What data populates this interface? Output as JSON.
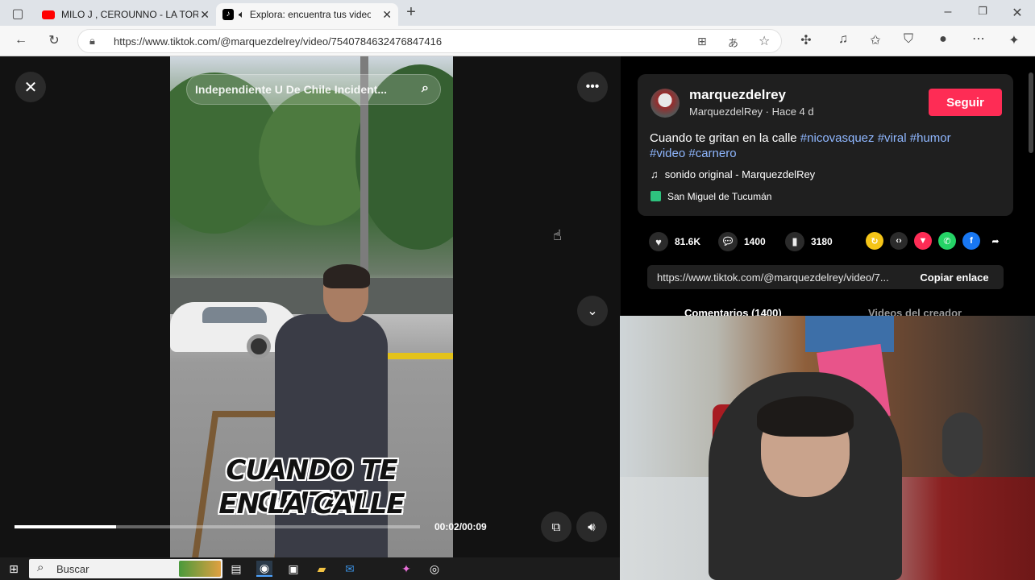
{
  "browser": {
    "tabs": [
      {
        "label": "MILO J , CEROUNNO - LA TORTUGA",
        "icon": "youtube-icon"
      },
      {
        "label": "Explora: encuentra tus videos",
        "icon": "tiktok-icon"
      }
    ],
    "new_tab_symbol": "+",
    "url": "https://www.tiktok.com/@marquezdelrey/video/7540784632476847416",
    "window_controls": {
      "minimize": "–",
      "restore": "❐",
      "close": "✕"
    }
  },
  "video": {
    "search_text": "Independiente U De Chile Incident...",
    "caption_line1": "CUANDO TE GRITAN",
    "caption_line2": "EN LA CALLE",
    "timecode": "00:02/00:09",
    "progress_fraction": 0.25
  },
  "panel": {
    "username": "marquezdelrey",
    "subline": "MarquezdelRey · Hace 4 d",
    "follow_label": "Seguir",
    "description_text": "Cuando te gritan en la calle",
    "hashtags_line1": [
      "#nicovasquez",
      "#viral",
      "#humor"
    ],
    "hashtags_line2": [
      "#video",
      "#carnero"
    ],
    "sound": "sonido original - MarquezdelRey",
    "location": "San Miguel de Tucumán",
    "likes": "81.6K",
    "comments": "1400",
    "saves": "3180",
    "link": "https://www.tiktok.com/@marquezdelrey/video/7...",
    "copy_label": "Copiar enlace",
    "tab_comments": "Comentarios (1400)",
    "tab_creator": "Videos del creador",
    "accent": "#fe2c55",
    "hashtag_color": "#8fb7ff"
  },
  "taskbar": {
    "search_label": "Buscar"
  }
}
